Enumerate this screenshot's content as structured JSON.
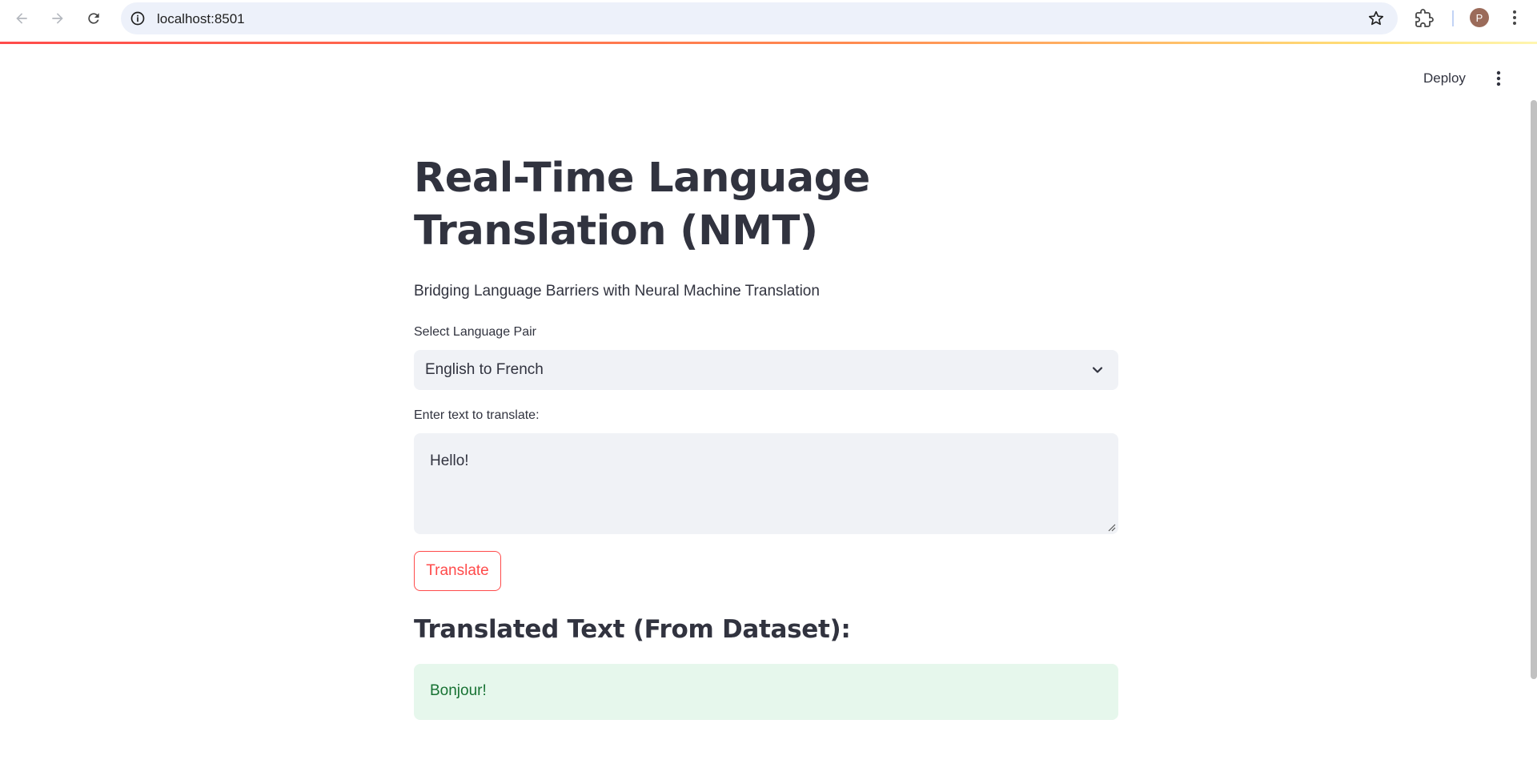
{
  "browser": {
    "url": "localhost:8501",
    "profile_initial": "P"
  },
  "header": {
    "deploy_label": "Deploy"
  },
  "main": {
    "title": "Real-Time Language Translation (NMT)",
    "subtitle": "Bridging Language Barriers with Neural Machine Translation",
    "language_select": {
      "label": "Select Language Pair",
      "value": "English to French"
    },
    "text_input": {
      "label": "Enter text to translate:",
      "value": "Hello!"
    },
    "translate_button": "Translate",
    "result_heading": "Translated Text (From Dataset):",
    "result_text": "Bonjour!"
  },
  "colors": {
    "accent": "#ff4b4b",
    "success_bg": "#e6f7ec",
    "success_text": "#177233",
    "input_bg": "#f0f2f6"
  }
}
